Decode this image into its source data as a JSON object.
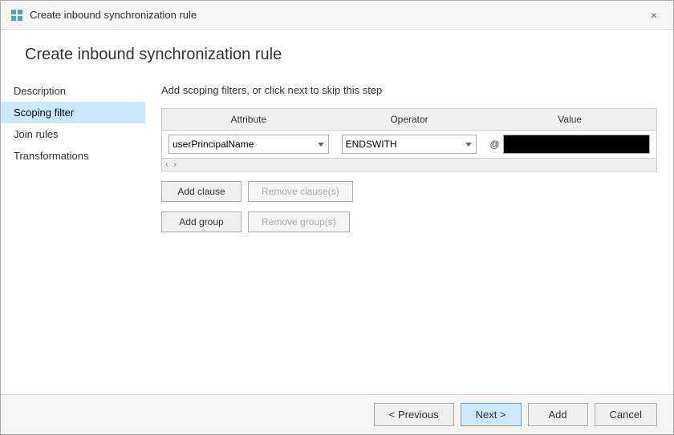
{
  "titleBar": {
    "title": "Create inbound synchronization rule",
    "closeLabel": "×"
  },
  "pageTitle": "Create inbound synchronization rule",
  "sidebar": {
    "items": [
      {
        "id": "description",
        "label": "Description",
        "active": false
      },
      {
        "id": "scoping-filter",
        "label": "Scoping filter",
        "active": true
      },
      {
        "id": "join-rules",
        "label": "Join rules",
        "active": false
      },
      {
        "id": "transformations",
        "label": "Transformations",
        "active": false
      }
    ]
  },
  "main": {
    "stepDescription": "Add scoping filters, or click next to skip this step",
    "table": {
      "columns": [
        "Attribute",
        "Operator",
        "Value"
      ],
      "rows": [
        {
          "attribute": "userPrincipalName",
          "operator": "ENDSWITH",
          "valuePrefix": "@",
          "value": ""
        }
      ]
    },
    "clauseButtons": {
      "addClause": "Add clause",
      "removeClause": "Remove clause(s)"
    },
    "groupButtons": {
      "addGroup": "Add group",
      "removeGroup": "Remove group(s)"
    }
  },
  "footer": {
    "previous": "< Previous",
    "next": "Next >",
    "add": "Add",
    "cancel": "Cancel"
  }
}
